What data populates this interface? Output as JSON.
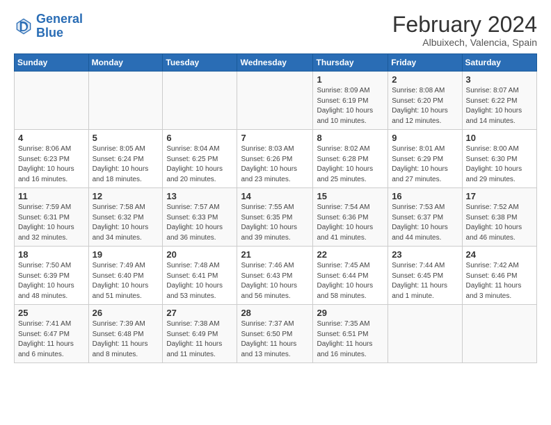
{
  "header": {
    "logo_line1": "General",
    "logo_line2": "Blue",
    "main_title": "February 2024",
    "subtitle": "Albuixech, Valencia, Spain"
  },
  "columns": [
    "Sunday",
    "Monday",
    "Tuesday",
    "Wednesday",
    "Thursday",
    "Friday",
    "Saturday"
  ],
  "weeks": [
    [
      {
        "day": "",
        "info": ""
      },
      {
        "day": "",
        "info": ""
      },
      {
        "day": "",
        "info": ""
      },
      {
        "day": "",
        "info": ""
      },
      {
        "day": "1",
        "info": "Sunrise: 8:09 AM\nSunset: 6:19 PM\nDaylight: 10 hours\nand 10 minutes."
      },
      {
        "day": "2",
        "info": "Sunrise: 8:08 AM\nSunset: 6:20 PM\nDaylight: 10 hours\nand 12 minutes."
      },
      {
        "day": "3",
        "info": "Sunrise: 8:07 AM\nSunset: 6:22 PM\nDaylight: 10 hours\nand 14 minutes."
      }
    ],
    [
      {
        "day": "4",
        "info": "Sunrise: 8:06 AM\nSunset: 6:23 PM\nDaylight: 10 hours\nand 16 minutes."
      },
      {
        "day": "5",
        "info": "Sunrise: 8:05 AM\nSunset: 6:24 PM\nDaylight: 10 hours\nand 18 minutes."
      },
      {
        "day": "6",
        "info": "Sunrise: 8:04 AM\nSunset: 6:25 PM\nDaylight: 10 hours\nand 20 minutes."
      },
      {
        "day": "7",
        "info": "Sunrise: 8:03 AM\nSunset: 6:26 PM\nDaylight: 10 hours\nand 23 minutes."
      },
      {
        "day": "8",
        "info": "Sunrise: 8:02 AM\nSunset: 6:28 PM\nDaylight: 10 hours\nand 25 minutes."
      },
      {
        "day": "9",
        "info": "Sunrise: 8:01 AM\nSunset: 6:29 PM\nDaylight: 10 hours\nand 27 minutes."
      },
      {
        "day": "10",
        "info": "Sunrise: 8:00 AM\nSunset: 6:30 PM\nDaylight: 10 hours\nand 29 minutes."
      }
    ],
    [
      {
        "day": "11",
        "info": "Sunrise: 7:59 AM\nSunset: 6:31 PM\nDaylight: 10 hours\nand 32 minutes."
      },
      {
        "day": "12",
        "info": "Sunrise: 7:58 AM\nSunset: 6:32 PM\nDaylight: 10 hours\nand 34 minutes."
      },
      {
        "day": "13",
        "info": "Sunrise: 7:57 AM\nSunset: 6:33 PM\nDaylight: 10 hours\nand 36 minutes."
      },
      {
        "day": "14",
        "info": "Sunrise: 7:55 AM\nSunset: 6:35 PM\nDaylight: 10 hours\nand 39 minutes."
      },
      {
        "day": "15",
        "info": "Sunrise: 7:54 AM\nSunset: 6:36 PM\nDaylight: 10 hours\nand 41 minutes."
      },
      {
        "day": "16",
        "info": "Sunrise: 7:53 AM\nSunset: 6:37 PM\nDaylight: 10 hours\nand 44 minutes."
      },
      {
        "day": "17",
        "info": "Sunrise: 7:52 AM\nSunset: 6:38 PM\nDaylight: 10 hours\nand 46 minutes."
      }
    ],
    [
      {
        "day": "18",
        "info": "Sunrise: 7:50 AM\nSunset: 6:39 PM\nDaylight: 10 hours\nand 48 minutes."
      },
      {
        "day": "19",
        "info": "Sunrise: 7:49 AM\nSunset: 6:40 PM\nDaylight: 10 hours\nand 51 minutes."
      },
      {
        "day": "20",
        "info": "Sunrise: 7:48 AM\nSunset: 6:41 PM\nDaylight: 10 hours\nand 53 minutes."
      },
      {
        "day": "21",
        "info": "Sunrise: 7:46 AM\nSunset: 6:43 PM\nDaylight: 10 hours\nand 56 minutes."
      },
      {
        "day": "22",
        "info": "Sunrise: 7:45 AM\nSunset: 6:44 PM\nDaylight: 10 hours\nand 58 minutes."
      },
      {
        "day": "23",
        "info": "Sunrise: 7:44 AM\nSunset: 6:45 PM\nDaylight: 11 hours\nand 1 minute."
      },
      {
        "day": "24",
        "info": "Sunrise: 7:42 AM\nSunset: 6:46 PM\nDaylight: 11 hours\nand 3 minutes."
      }
    ],
    [
      {
        "day": "25",
        "info": "Sunrise: 7:41 AM\nSunset: 6:47 PM\nDaylight: 11 hours\nand 6 minutes."
      },
      {
        "day": "26",
        "info": "Sunrise: 7:39 AM\nSunset: 6:48 PM\nDaylight: 11 hours\nand 8 minutes."
      },
      {
        "day": "27",
        "info": "Sunrise: 7:38 AM\nSunset: 6:49 PM\nDaylight: 11 hours\nand 11 minutes."
      },
      {
        "day": "28",
        "info": "Sunrise: 7:37 AM\nSunset: 6:50 PM\nDaylight: 11 hours\nand 13 minutes."
      },
      {
        "day": "29",
        "info": "Sunrise: 7:35 AM\nSunset: 6:51 PM\nDaylight: 11 hours\nand 16 minutes."
      },
      {
        "day": "",
        "info": ""
      },
      {
        "day": "",
        "info": ""
      }
    ]
  ]
}
